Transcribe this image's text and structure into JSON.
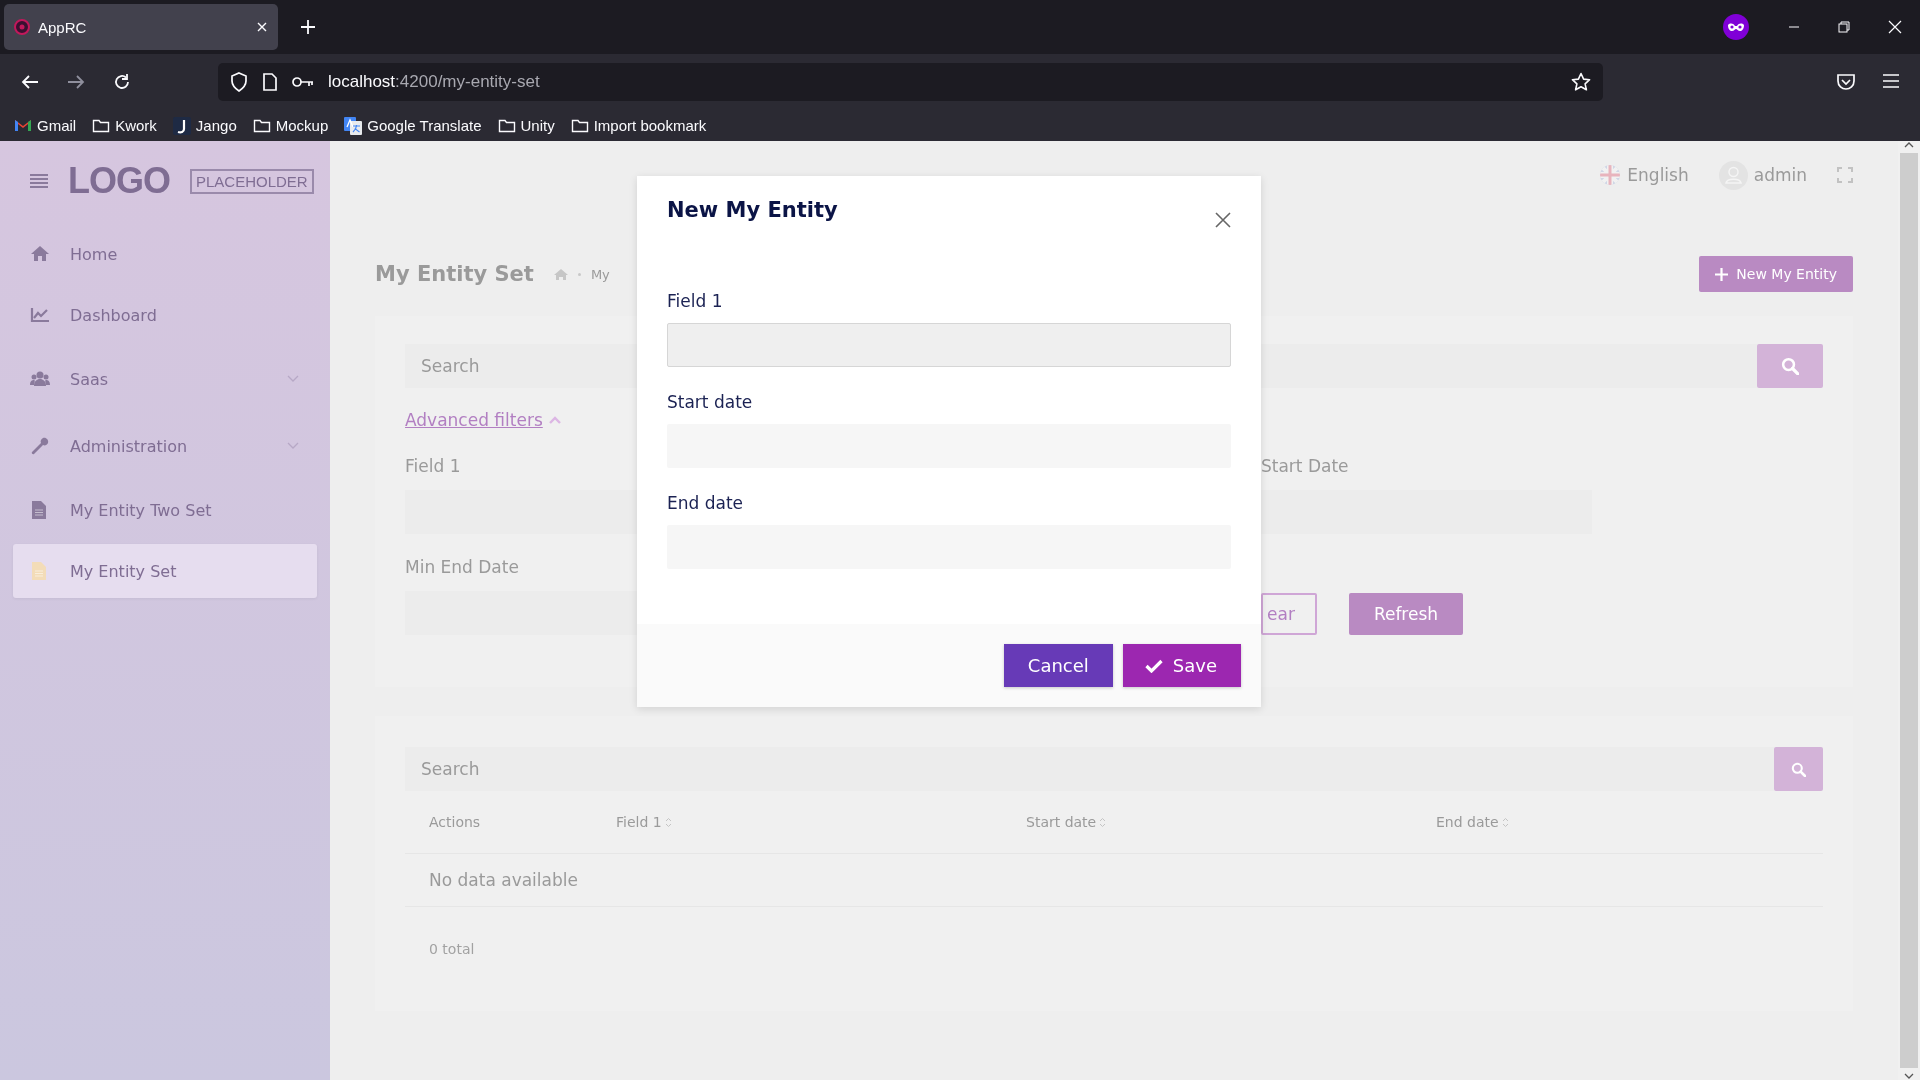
{
  "browser": {
    "tab": {
      "title": "AppRC"
    },
    "url": {
      "host": "localhost",
      "path": ":4200/my-entity-set"
    },
    "bookmarks": [
      {
        "label": "Gmail",
        "kind": "gmail"
      },
      {
        "label": "Kwork",
        "kind": "folder"
      },
      {
        "label": "Jango",
        "kind": "jango"
      },
      {
        "label": "Mockup",
        "kind": "folder"
      },
      {
        "label": "Google Translate",
        "kind": "translate"
      },
      {
        "label": "Unity",
        "kind": "folder"
      },
      {
        "label": "Import bookmark",
        "kind": "folder"
      }
    ]
  },
  "sidebar": {
    "logo": {
      "word": "LOGO",
      "tag": "PLACEHOLDER"
    },
    "items": [
      {
        "label": "Home",
        "kind": "home",
        "expandable": false,
        "selected": false
      },
      {
        "label": "Dashboard",
        "kind": "chart",
        "expandable": false,
        "selected": false
      },
      {
        "label": "Saas",
        "kind": "users",
        "expandable": true,
        "selected": false
      },
      {
        "label": "Administration",
        "kind": "wrench",
        "expandable": true,
        "selected": false
      },
      {
        "label": "My Entity Two Set",
        "kind": "file",
        "expandable": false,
        "selected": false
      },
      {
        "label": "My Entity Set",
        "kind": "file",
        "expandable": false,
        "selected": true
      }
    ]
  },
  "header": {
    "language": "English",
    "user": "admin"
  },
  "page": {
    "title": "My Entity Set",
    "breadcrumb": "My",
    "new_button": "New My Entity"
  },
  "filters": {
    "search_placeholder": "Search",
    "advanced_label": "Advanced filters",
    "expanded": true,
    "rows": [
      {
        "left": {
          "label": "Field 1"
        },
        "right": {
          "label": "Start Date"
        }
      },
      {
        "left": {
          "label": "Min End Date"
        }
      }
    ],
    "buttons": [
      {
        "label": "ear",
        "kind": "outline"
      },
      {
        "label": "Refresh",
        "kind": "filled"
      }
    ]
  },
  "table": {
    "search_placeholder": "Search",
    "columns": [
      {
        "label": "Actions",
        "sortable": false
      },
      {
        "label": "Field 1",
        "sortable": true
      },
      {
        "label": "Start date",
        "sortable": true
      },
      {
        "label": "End date",
        "sortable": true
      }
    ],
    "empty": "No data available",
    "total": "0 total"
  },
  "modal": {
    "title": "New My Entity",
    "fields": [
      {
        "label": "Field 1",
        "focused": true
      },
      {
        "label": "Start date",
        "focused": false
      },
      {
        "label": "End date",
        "focused": false
      }
    ],
    "buttons": [
      {
        "label": "Cancel",
        "kind": "cancel"
      },
      {
        "label": "Save",
        "kind": "save"
      }
    ]
  }
}
